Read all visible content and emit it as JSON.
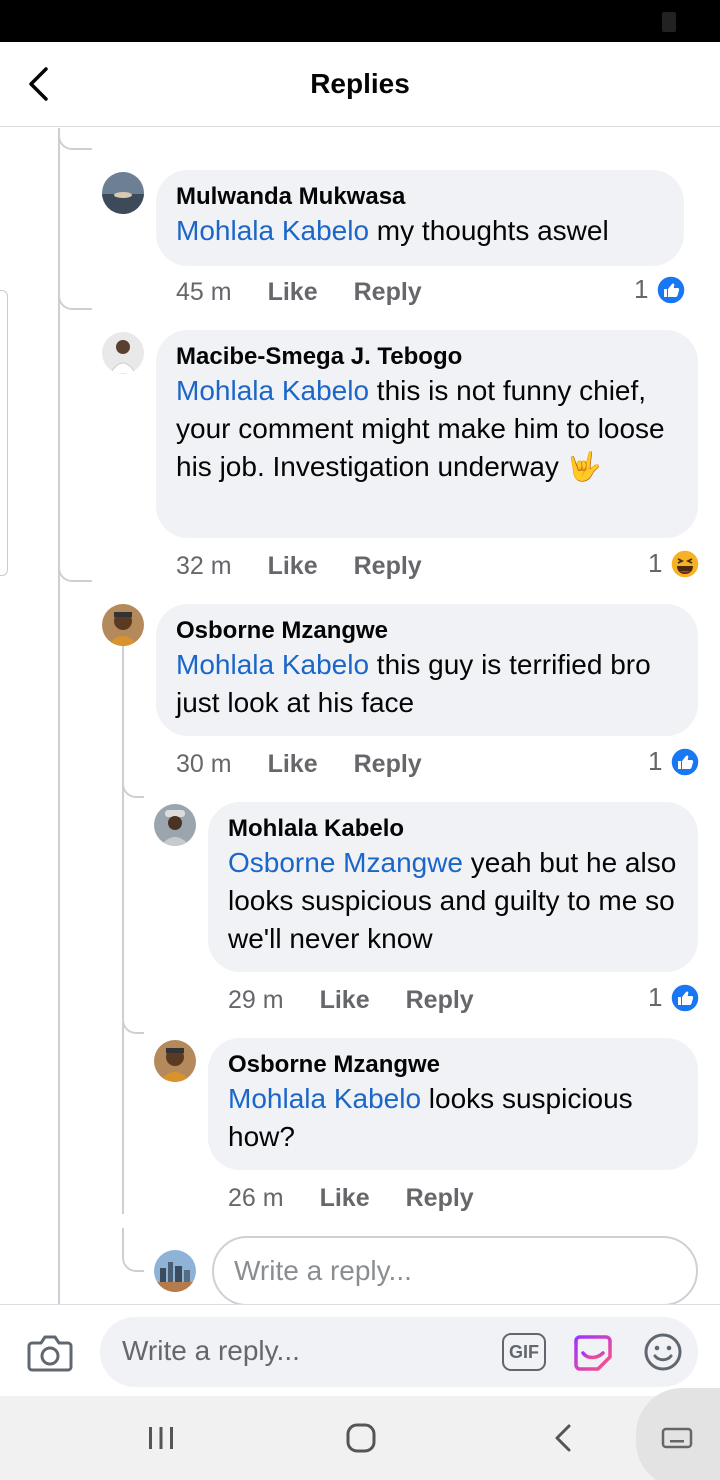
{
  "header": {
    "title": "Replies"
  },
  "comments": [
    {
      "author": "Mulwanda Mukwasa",
      "mention": "Mohlala Kabelo",
      "text": " my thoughts aswel",
      "time": "45 m",
      "like": "Like",
      "reply": "Reply",
      "reaction_count": "1",
      "reaction": "like"
    },
    {
      "author": "Macibe-Smega J. Tebogo",
      "mention": "Mohlala Kabelo",
      "text": " this is not funny chief, your comment might make him to loose his job. Investigation underway 🤟",
      "time": "32 m",
      "like": "Like",
      "reply": "Reply",
      "reaction_count": "1",
      "reaction": "haha"
    },
    {
      "author": "Osborne Mzangwe",
      "mention": "Mohlala Kabelo",
      "text": " this guy is terrified bro just look at his face",
      "time": "30 m",
      "like": "Like",
      "reply": "Reply",
      "reaction_count": "1",
      "reaction": "like"
    },
    {
      "author": "Mohlala Kabelo",
      "mention": "Osborne Mzangwe",
      "text": " yeah but he also looks suspicious and guilty to me so we'll never know",
      "time": "29 m",
      "like": "Like",
      "reply": "Reply",
      "reaction_count": "1",
      "reaction": "like"
    },
    {
      "author": "Osborne Mzangwe",
      "mention": "Mohlala Kabelo",
      "text": " looks suspicious how?",
      "time": "26 m",
      "like": "Like",
      "reply": "Reply",
      "reaction_count": "",
      "reaction": ""
    }
  ],
  "thread_reply": {
    "placeholder": "Write a reply..."
  },
  "composer": {
    "placeholder": "Write a reply...",
    "gif_label": "GIF"
  },
  "colors": {
    "mention": "#1b66c9",
    "like_blue": "#1877f2",
    "bubble": "#f0f2f5",
    "meta_gray": "#65676b"
  },
  "icons": [
    "back-arrow-icon",
    "like-reaction-icon",
    "haha-reaction-icon",
    "camera-icon",
    "gif-icon",
    "sticker-icon",
    "emoji-icon",
    "recent-apps-icon",
    "home-icon",
    "back-nav-icon",
    "keyboard-icon"
  ]
}
